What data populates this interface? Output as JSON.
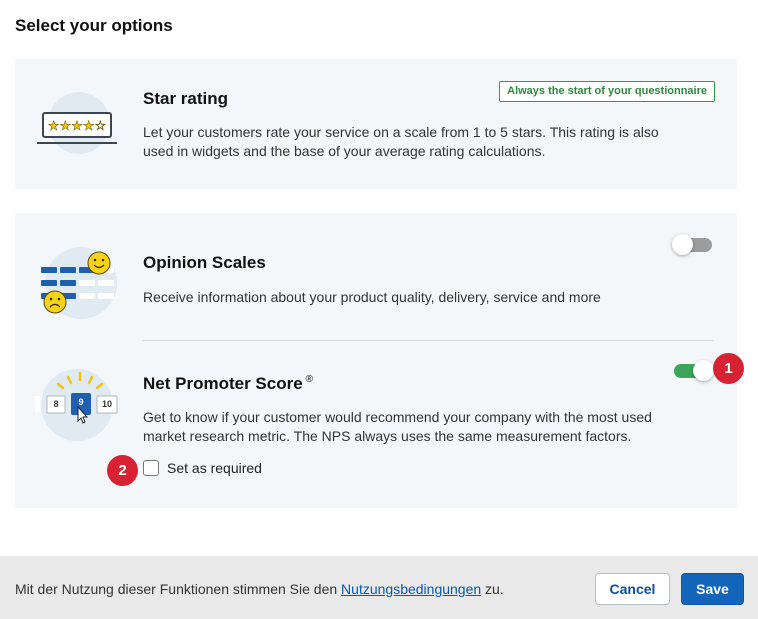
{
  "page_title": "Select your options",
  "star_rating": {
    "title": "Star rating",
    "badge": "Always the start of your questionnaire",
    "description_line1": "Let your customers rate your service on a scale from 1 to 5 stars. This rating is also",
    "description_line2": "used in widgets and the base of your average rating calculations.",
    "stars": "★★★★☆"
  },
  "opinion_scales": {
    "title": "Opinion Scales",
    "description": "Receive information about your product quality, delivery, service and more",
    "enabled": false
  },
  "nps": {
    "title": "Net Promoter Score",
    "trademark": "®",
    "description_line1": "Get to know if your customer would recommend your company with the most used",
    "description_line2": "market research metric. The NPS always uses the same measurement factors.",
    "enabled": true,
    "scale": [
      "8",
      "9",
      "10"
    ],
    "required_label": "Set as required",
    "required": false
  },
  "callouts": {
    "one": "1",
    "two": "2"
  },
  "footer": {
    "text_before": "Mit der Nutzung dieser Funktionen stimmen Sie den ",
    "link": "Nutzungsbedingungen",
    "text_after": " zu.",
    "cancel_label": "Cancel",
    "save_label": "Save"
  },
  "colors": {
    "accent": "#1265b8",
    "toggle_on": "#3ea45a",
    "badge_green": "#2f9e44",
    "callout_red": "#d62232"
  }
}
